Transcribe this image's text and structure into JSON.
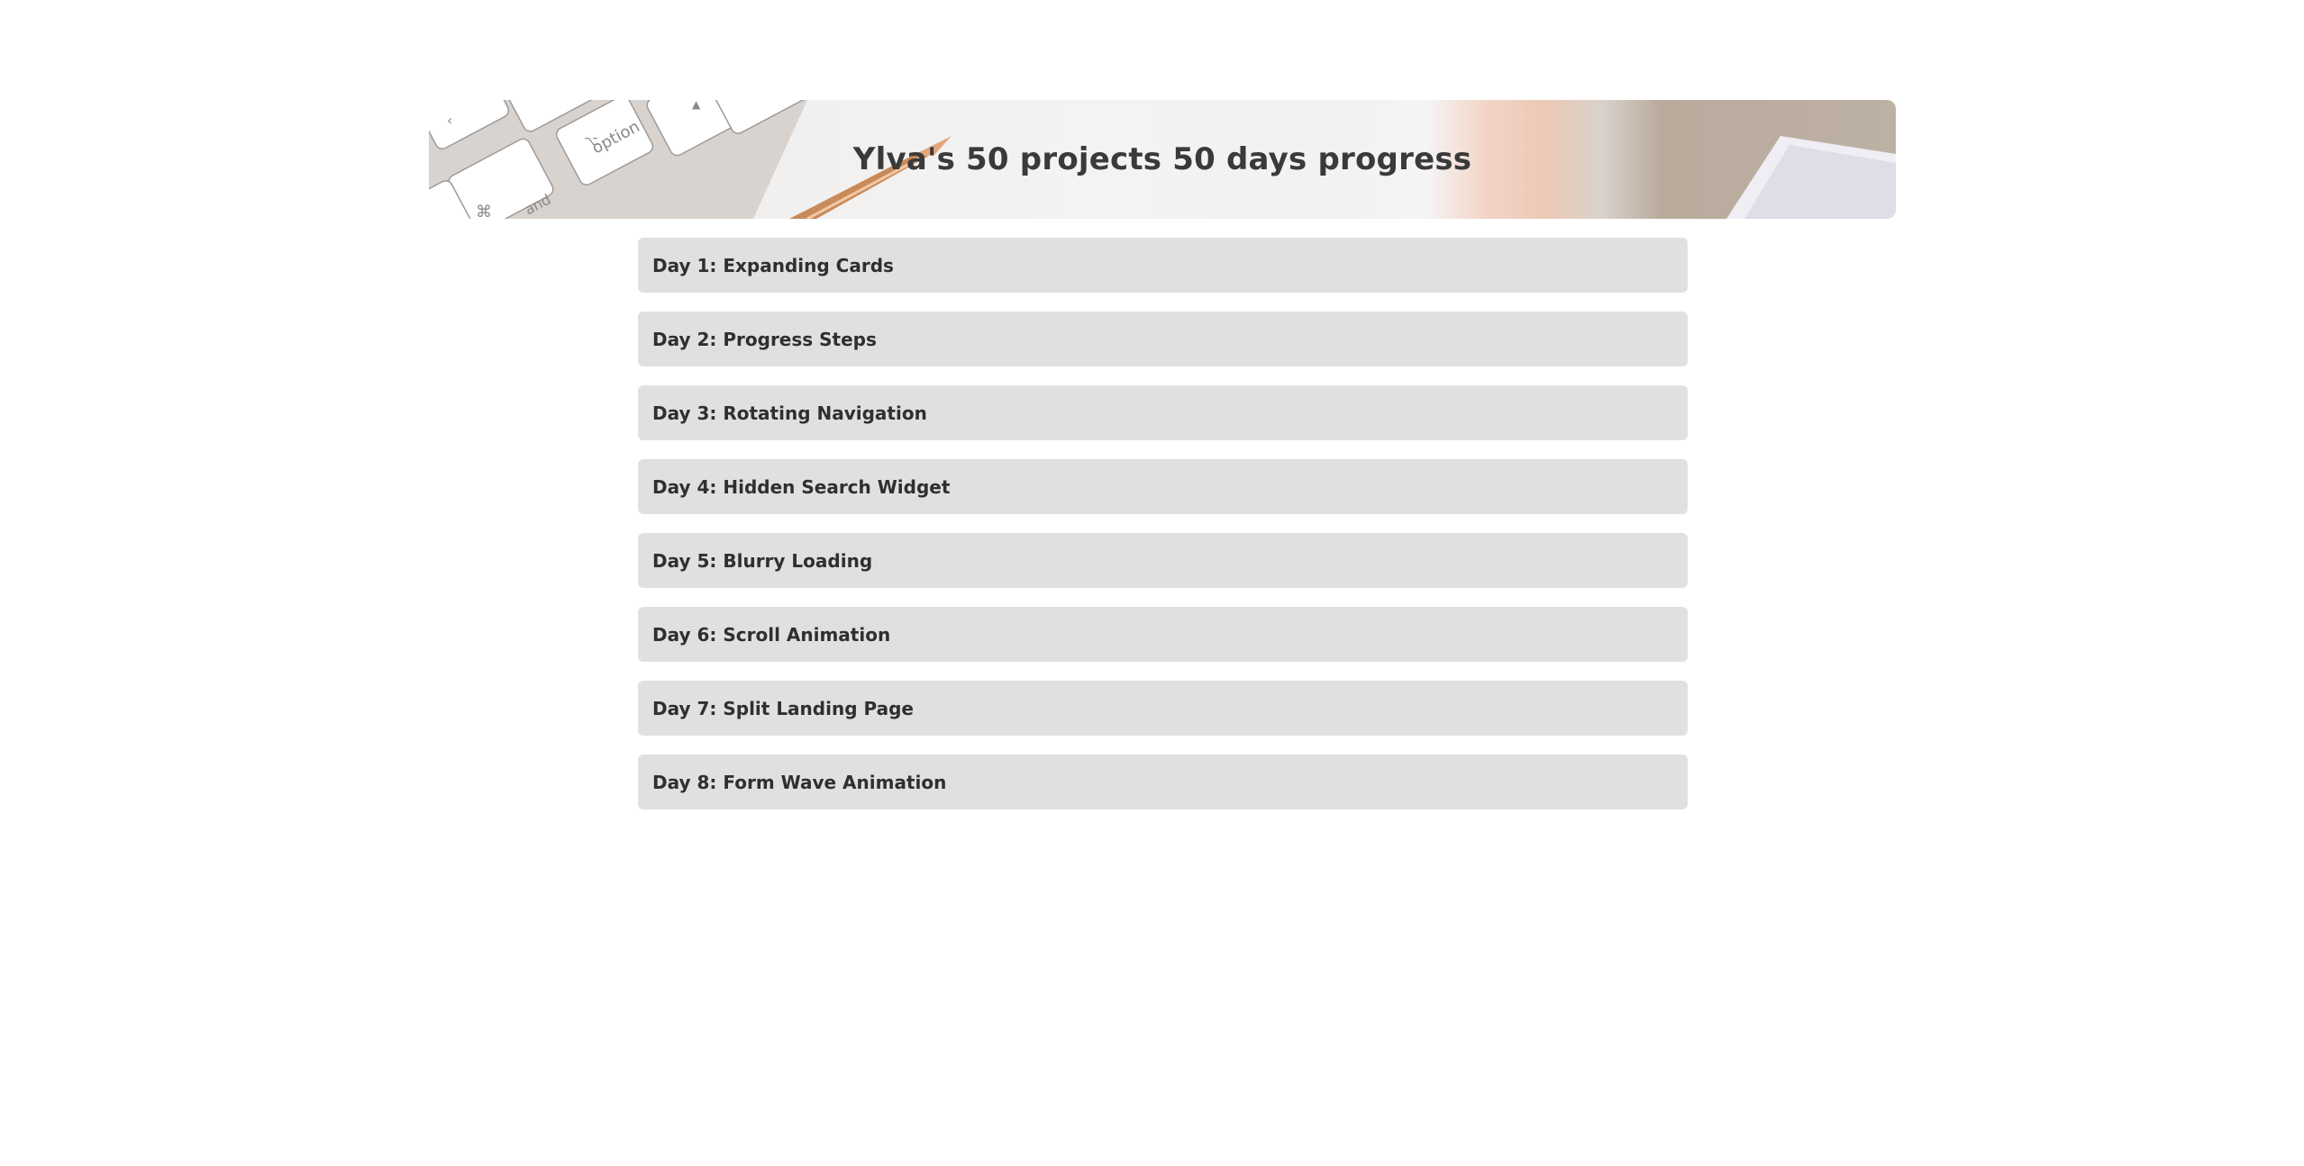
{
  "header": {
    "title": "Ylva's 50 projects 50 days progress"
  },
  "projects": [
    {
      "label": "Day 1: Expanding Cards"
    },
    {
      "label": "Day 2: Progress Steps"
    },
    {
      "label": "Day 3: Rotating Navigation"
    },
    {
      "label": "Day 4: Hidden Search Widget"
    },
    {
      "label": "Day 5: Blurry Loading"
    },
    {
      "label": "Day 6: Scroll Animation"
    },
    {
      "label": "Day 7: Split Landing Page"
    },
    {
      "label": "Day 8: Form Wave Animation"
    }
  ]
}
